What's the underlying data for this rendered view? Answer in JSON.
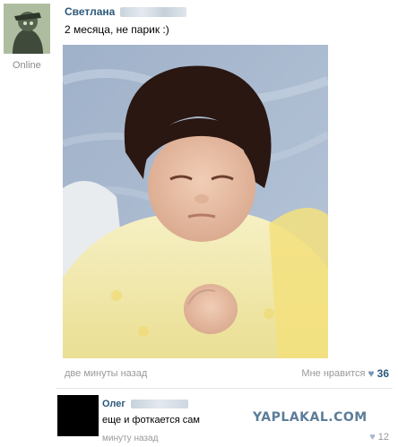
{
  "post": {
    "author": "Светлана",
    "status": "Online",
    "text": "2 месяца, не парик :)",
    "time": "две минуты назад",
    "like_label": "Мне нравится",
    "like_icon": "heart-icon",
    "like_count": "36"
  },
  "comment": {
    "author": "Олег",
    "text": "еще и фоткается сам",
    "time": "минуту назад",
    "like_icon": "heart-icon",
    "like_count": "12"
  },
  "watermark": "YAPLAKAL.COM",
  "colors": {
    "link": "#2b587a",
    "muted": "#999999",
    "heart": "#7796b3",
    "divider": "#e4e8ed"
  }
}
